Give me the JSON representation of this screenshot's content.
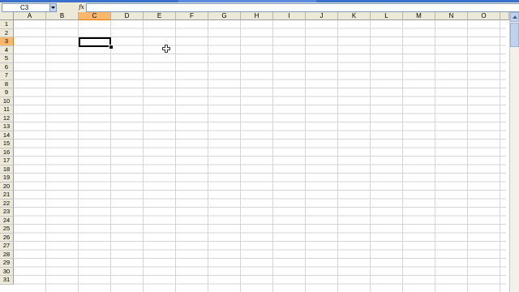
{
  "formula_bar": {
    "name_box_value": "C3",
    "fx_label": "fx",
    "formula_value": ""
  },
  "grid": {
    "columns": [
      "A",
      "B",
      "C",
      "D",
      "E",
      "F",
      "G",
      "H",
      "I",
      "J",
      "K",
      "L",
      "M",
      "N",
      "O"
    ],
    "rows": [
      "1",
      "2",
      "3",
      "4",
      "5",
      "6",
      "7",
      "8",
      "9",
      "10",
      "11",
      "12",
      "13",
      "14",
      "15",
      "16",
      "17",
      "18",
      "19",
      "20",
      "21",
      "22",
      "23",
      "24",
      "25",
      "26",
      "27",
      "28",
      "29",
      "30",
      "31"
    ],
    "active_column": "C",
    "active_row": "3"
  },
  "colors": {
    "header_bg": "#ece9d8",
    "active_header": "#f9b76e",
    "gridline": "#d4d4d4",
    "titlebar": "#3b6fce"
  },
  "icons": {
    "name_box_dropdown": "chevron-down-icon",
    "cursor": "cross-cursor-icon",
    "scroll_up": "arrow-up-icon"
  }
}
